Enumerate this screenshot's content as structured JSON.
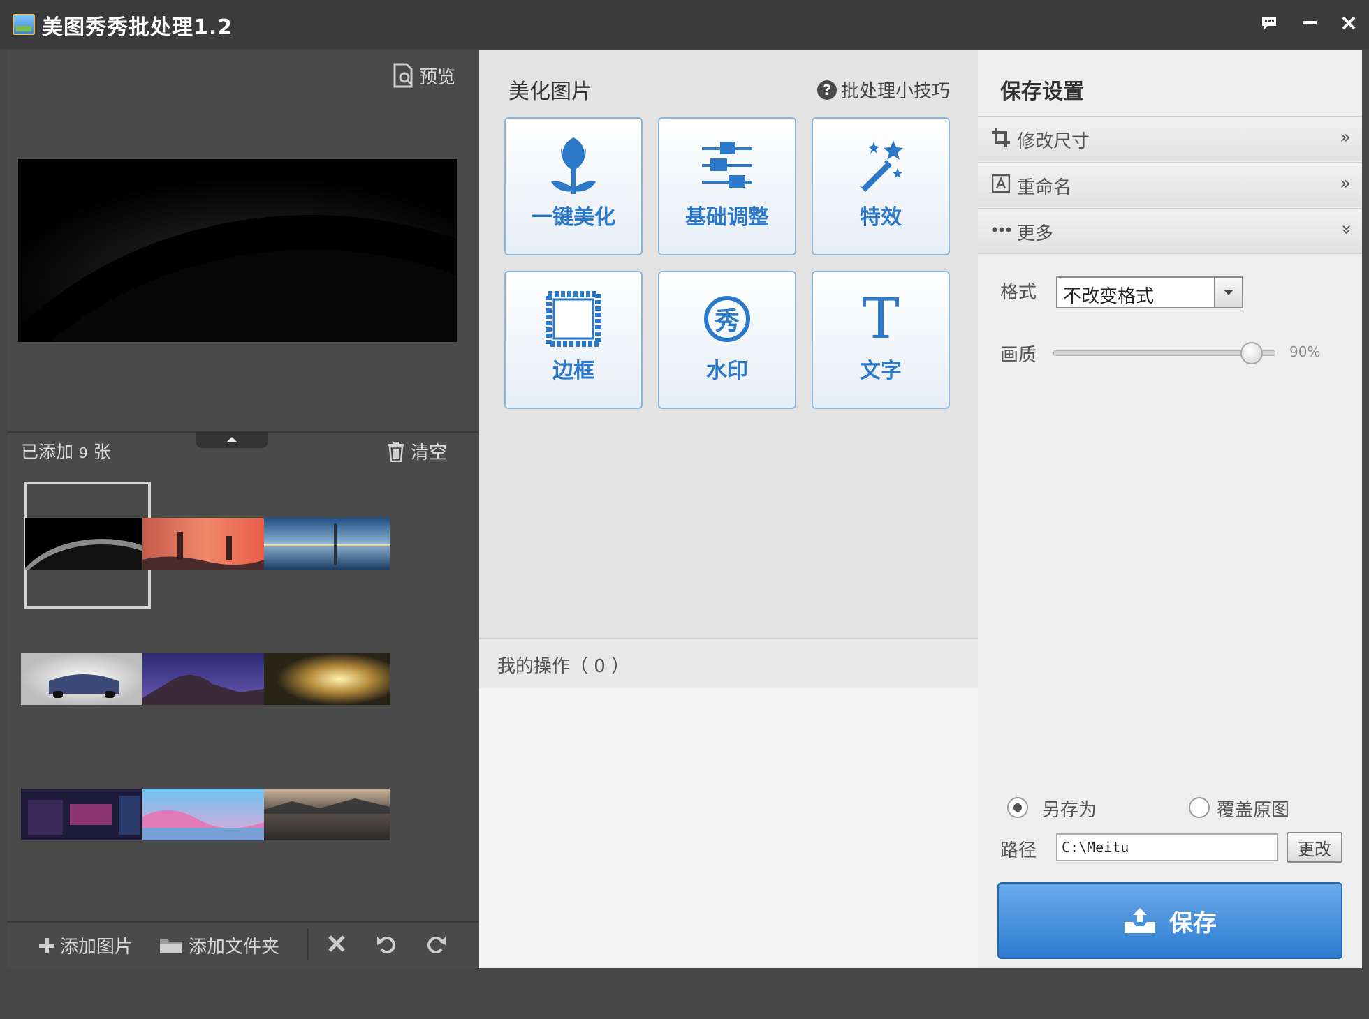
{
  "window": {
    "title": "美图秀秀批处理1.2",
    "buttons": [
      "feedback-icon",
      "minimize-icon",
      "close-icon"
    ]
  },
  "left": {
    "preview_label": "预览",
    "added_prefix": "已添加",
    "added_count": "9",
    "added_suffix": "张",
    "clear_label": "清空",
    "bottom": {
      "add_image": "添加图片",
      "add_folder": "添加文件夹"
    },
    "icons": [
      "preview-icon",
      "collapse-up-icon",
      "trash-icon",
      "plus-icon",
      "folder-icon",
      "delete-x-icon",
      "rotate-left-icon",
      "rotate-right-icon"
    ]
  },
  "center": {
    "title": "美化图片",
    "tips": "批处理小技巧",
    "tiles": [
      {
        "label": "一键美化",
        "icon": "tulip-icon"
      },
      {
        "label": "基础调整",
        "icon": "sliders-icon"
      },
      {
        "label": "特效",
        "icon": "magic-wand-icon"
      },
      {
        "label": "边框",
        "icon": "frame-icon"
      },
      {
        "label": "水印",
        "icon": "watermark-xiu-icon"
      },
      {
        "label": "文字",
        "icon": "text-t-icon"
      }
    ],
    "watermark_glyph": "秀",
    "text_glyph": "T",
    "my_ops_label": "我的操作",
    "my_ops_count": "（ 0 ）"
  },
  "right": {
    "title": "保存设置",
    "sections": [
      {
        "label": "修改尺寸",
        "icon": "crop-icon"
      },
      {
        "label": "重命名",
        "icon": "rename-a-icon"
      },
      {
        "label": "更多",
        "icon": "more-dots-icon"
      }
    ],
    "format_label": "格式",
    "format_value": "不改变格式",
    "quality_label": "画质",
    "quality_value": "90%",
    "quality_fraction": 0.9,
    "save_as_label": "另存为",
    "overwrite_label": "覆盖原图",
    "save_mode": "save_as",
    "path_label": "路径",
    "path_value": "C:\\Meitu",
    "change_label": "更改",
    "save_label": "保存"
  },
  "colors": {
    "accent_blue": "#2c79c9",
    "save_button": "#3d8ad8",
    "dark_bg": "#474747",
    "center_bg": "#e3e3e3"
  }
}
